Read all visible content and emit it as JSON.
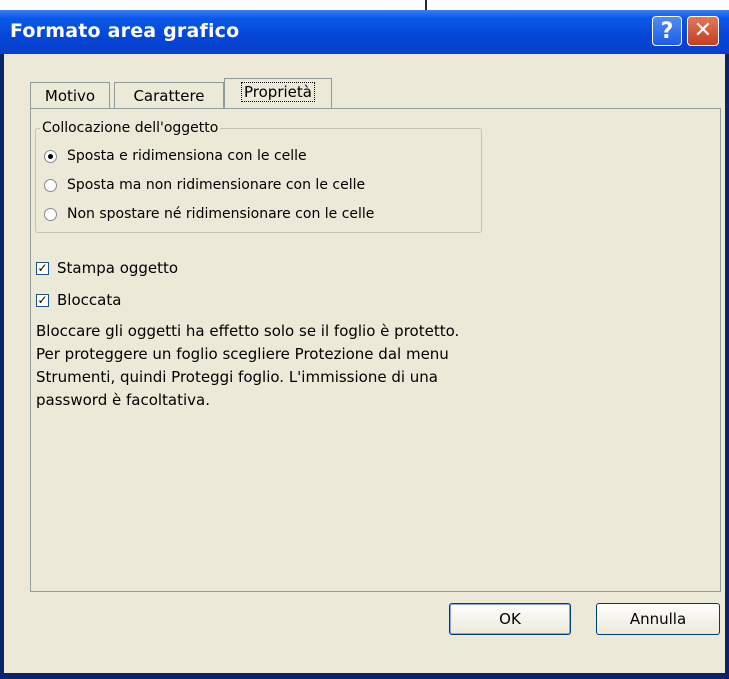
{
  "dialog": {
    "title": "Formato area grafico",
    "help_glyph": "?",
    "close_glyph": "✕"
  },
  "tabs": [
    {
      "label": "Motivo",
      "active": false
    },
    {
      "label": "Carattere",
      "active": false
    },
    {
      "label": "Proprietà",
      "active": true
    }
  ],
  "placement": {
    "group_label": "Collocazione dell'oggetto",
    "options": [
      {
        "label": "Sposta e ridimensiona con le celle",
        "selected": true
      },
      {
        "label": "Sposta ma non ridimensionare con le celle",
        "selected": false
      },
      {
        "label": "Non spostare né ridimensionare con le celle",
        "selected": false
      }
    ]
  },
  "checkboxes": [
    {
      "label": "Stampa oggetto",
      "checked": true
    },
    {
      "label": "Bloccata",
      "checked": true
    }
  ],
  "note_lines": [
    "Bloccare gli oggetti ha effetto solo se il foglio è protetto.",
    "Per proteggere un foglio scegliere Protezione dal menu",
    "Strumenti, quindi Proteggi foglio. L'immissione di una",
    "password è facoltativa."
  ],
  "buttons": {
    "ok": "OK",
    "cancel": "Annulla"
  },
  "colors": {
    "title_bar": "#0a5ae8",
    "dialog_face": "#ece9d8",
    "close_button": "#c1401e"
  }
}
